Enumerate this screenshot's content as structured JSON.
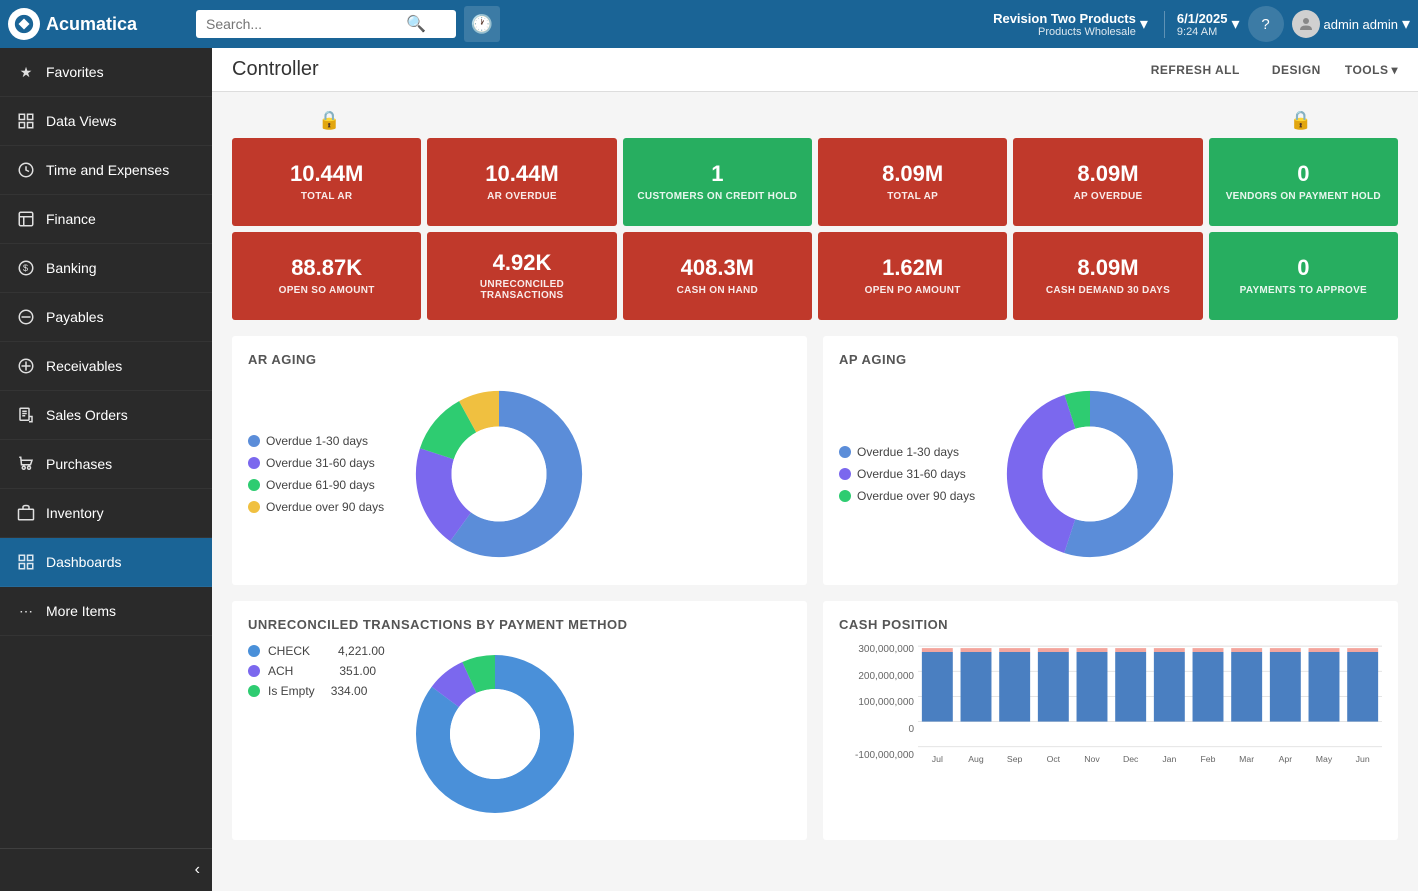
{
  "topnav": {
    "logo_text": "Acumatica",
    "search_placeholder": "Search...",
    "history_icon": "🕐",
    "company_name": "Revision Two Products",
    "company_sub": "Products Wholesale",
    "date": "6/1/2025",
    "time": "9:24 AM",
    "help_icon": "?",
    "user_name": "admin admin",
    "chevron_icon": "▾"
  },
  "header": {
    "title": "Controller",
    "refresh_all_label": "REFRESH ALL",
    "design_label": "DESIGN",
    "tools_label": "TOOLS"
  },
  "sidebar": {
    "items": [
      {
        "id": "favorites",
        "label": "Favorites",
        "icon": "★"
      },
      {
        "id": "data-views",
        "label": "Data Views",
        "icon": "⊞"
      },
      {
        "id": "time-expenses",
        "label": "Time and Expenses",
        "icon": "⏱"
      },
      {
        "id": "finance",
        "label": "Finance",
        "icon": "⊟"
      },
      {
        "id": "banking",
        "label": "Banking",
        "icon": "$"
      },
      {
        "id": "payables",
        "label": "Payables",
        "icon": "⊖"
      },
      {
        "id": "receivables",
        "label": "Receivables",
        "icon": "+"
      },
      {
        "id": "sales-orders",
        "label": "Sales Orders",
        "icon": "📋"
      },
      {
        "id": "purchases",
        "label": "Purchases",
        "icon": "🛒"
      },
      {
        "id": "inventory",
        "label": "Inventory",
        "icon": "📦"
      },
      {
        "id": "dashboards",
        "label": "Dashboards",
        "icon": "⊞",
        "active": true
      },
      {
        "id": "more-items",
        "label": "More Items",
        "icon": "⋯"
      }
    ],
    "collapse_icon": "‹"
  },
  "kpi_row1": [
    {
      "value": "10.44M",
      "label": "TOTAL AR",
      "color": "red",
      "lock": true
    },
    {
      "value": "10.44M",
      "label": "AR OVERDUE",
      "color": "red",
      "lock": false
    },
    {
      "value": "1",
      "label": "CUSTOMERS ON CREDIT HOLD",
      "color": "green",
      "lock": false
    },
    {
      "value": "8.09M",
      "label": "TOTAL AP",
      "color": "red",
      "lock": false
    },
    {
      "value": "8.09M",
      "label": "AP OVERDUE",
      "color": "red",
      "lock": false
    },
    {
      "value": "0",
      "label": "VENDORS ON PAYMENT HOLD",
      "color": "green",
      "lock": true
    }
  ],
  "kpi_row2": [
    {
      "value": "88.87K",
      "label": "OPEN SO AMOUNT",
      "color": "red"
    },
    {
      "value": "4.92K",
      "label": "UNRECONCILED TRANSACTIONS",
      "color": "red"
    },
    {
      "value": "408.3M",
      "label": "CASH ON HAND",
      "color": "red"
    },
    {
      "value": "1.62M",
      "label": "OPEN PO AMOUNT",
      "color": "red"
    },
    {
      "value": "8.09M",
      "label": "CASH DEMAND 30 DAYS",
      "color": "red"
    },
    {
      "value": "0",
      "label": "PAYMENTS TO APPROVE",
      "color": "green"
    }
  ],
  "ar_aging": {
    "title": "AR AGING",
    "legend": [
      {
        "label": "Overdue 1-30 days",
        "color": "#4a90d9"
      },
      {
        "label": "Overdue 31-60 days",
        "color": "#7b68ee"
      },
      {
        "label": "Overdue 61-90 days",
        "color": "#2ecc71"
      },
      {
        "label": "Overdue over 90 days",
        "color": "#f0c040"
      }
    ],
    "segments": [
      {
        "value": 60,
        "color": "#5b8dd9"
      },
      {
        "value": 20,
        "color": "#7b68ee"
      },
      {
        "value": 12,
        "color": "#2ecc71"
      },
      {
        "value": 8,
        "color": "#f0c040"
      }
    ]
  },
  "ap_aging": {
    "title": "AP AGING",
    "legend": [
      {
        "label": "Overdue 1-30 days",
        "color": "#4a90d9"
      },
      {
        "label": "Overdue 31-60 days",
        "color": "#7b68ee"
      },
      {
        "label": "Overdue over 90 days",
        "color": "#2ecc71"
      }
    ],
    "segments": [
      {
        "value": 55,
        "color": "#5b8dd9"
      },
      {
        "value": 40,
        "color": "#7b68ee"
      },
      {
        "value": 5,
        "color": "#2ecc71"
      }
    ]
  },
  "unreconciled": {
    "title": "UNRECONCILED TRANSACTIONS BY PAYMENT METHOD",
    "items": [
      {
        "label": "CHECK",
        "value": "4,221.00",
        "color": "#4a90d9"
      },
      {
        "label": "ACH",
        "value": "351.00",
        "color": "#7b68ee"
      },
      {
        "label": "Is Empty",
        "value": "334.00",
        "color": "#2ecc71"
      }
    ],
    "segments": [
      {
        "value": 85,
        "color": "#4a90d9"
      },
      {
        "value": 8,
        "color": "#7b68ee"
      },
      {
        "value": 7,
        "color": "#2ecc71"
      }
    ]
  },
  "cash_position": {
    "title": "CASH POSITION",
    "y_labels": [
      "300,000,000",
      "200,000,000",
      "100,000,000",
      "0",
      "-100,000,000"
    ],
    "x_labels": [
      "Jul",
      "Aug",
      "Sep",
      "Oct",
      "Nov",
      "Dec",
      "Jan",
      "Feb",
      "Mar",
      "Apr",
      "May",
      "Jun"
    ],
    "bar_color": "#4a7fc1",
    "line_color": "#e74c3c"
  }
}
